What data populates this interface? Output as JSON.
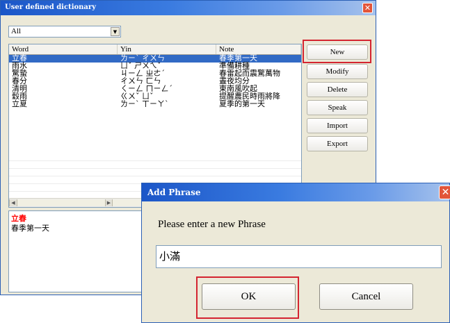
{
  "window": {
    "title": "User defined dictionary",
    "close_glyph": "✕"
  },
  "filter": {
    "value": "All",
    "arrow": "▼"
  },
  "list": {
    "headers": {
      "word": "Word",
      "yin": "Yin",
      "note": "Note"
    },
    "rows": [
      {
        "word": "立春",
        "yin": "ㄌㄧˋ ㄔㄨㄣ",
        "note": "春季第一天"
      },
      {
        "word": "雨水",
        "yin": "ㄩˇ ㄕㄨㄟˇ",
        "note": "準備耕種"
      },
      {
        "word": "驚蟄",
        "yin": "ㄐㄧㄥ ㄓㄜˊ",
        "note": "春雷起而震驚萬物"
      },
      {
        "word": "春分",
        "yin": "ㄔㄨㄣ ㄈㄣ",
        "note": "晝夜均分"
      },
      {
        "word": "清明",
        "yin": "ㄑㄧㄥ ㄇㄧㄥˊ",
        "note": "東南風吹起"
      },
      {
        "word": "穀雨",
        "yin": "ㄍㄨˇ ㄩˇ",
        "note": "提醒農民時雨將降"
      },
      {
        "word": "立夏",
        "yin": "ㄌㄧˋ ㄒㄧㄚˋ",
        "note": "夏季的第一天"
      }
    ],
    "scroll_left": "◀",
    "scroll_right": "▶"
  },
  "detail": {
    "word": "立春",
    "note": "春季第一天"
  },
  "buttons": {
    "new": "New",
    "modify": "Modify",
    "delete": "Delete",
    "speak": "Speak",
    "import": "Import",
    "export": "Export"
  },
  "dialog": {
    "title": "Add Phrase",
    "close_glyph": "✕",
    "prompt": "Please enter a new Phrase",
    "input_value": "小滿",
    "ok": "OK",
    "cancel": "Cancel"
  },
  "colors": {
    "highlight": "#d42430",
    "selection": "#316ac5",
    "detail_word": "#ff0000"
  }
}
